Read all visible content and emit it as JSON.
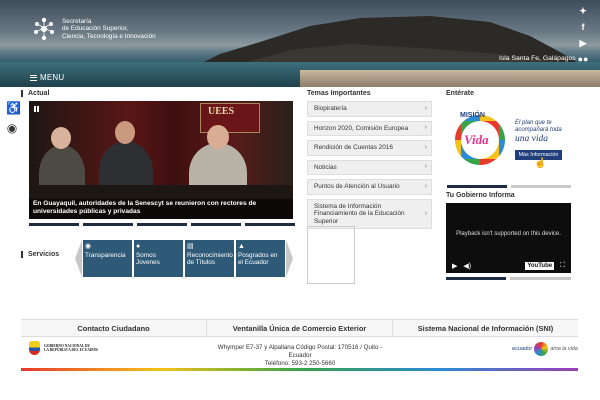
{
  "header": {
    "logo_lines": [
      "Secretaría",
      "de Educación Superior,",
      "Ciencia, Tecnología e Innovación"
    ],
    "menu_label": "MENU",
    "location": "Isla Santa Fe, Galápagos",
    "social_icons": [
      "twitter-icon",
      "facebook-icon",
      "youtube-icon",
      "flickr-icon"
    ]
  },
  "tools": [
    "accessibility-icon",
    "eye-icon"
  ],
  "actual": {
    "title": "Actual",
    "banner_text": "UEES",
    "caption": "En Guayaquil, autoridades de la Senescyt se reunieron con rectores de universidades públicas y privadas"
  },
  "servicios": {
    "title": "Servicios",
    "items": [
      {
        "icon": "eye-icon",
        "label": "Transparencia"
      },
      {
        "icon": "person-icon",
        "label": "Somos Jovenes"
      },
      {
        "icon": "document-icon",
        "label": "Reconocimiento de Títulos"
      },
      {
        "icon": "graduation-cap-icon",
        "label": "Posgrados en el Ecuador"
      }
    ]
  },
  "temas": {
    "title": "Temas Importantes",
    "items": [
      "Biopiratería",
      "Horizon 2020, Comisión Europea",
      "Rendición de Cuentas 2016",
      "Noticias",
      "Puntos de Atención al Usuario",
      "Sistema de Información Financiamiento de la Educación Superior"
    ]
  },
  "enterate": {
    "title": "Entérate",
    "mision": "MISIÓN",
    "vida": "Vida",
    "plan_text": "El plan que te acompañará toda",
    "una_vida": "una vida",
    "button": "Más Información"
  },
  "gobierno": {
    "title": "Tu Gobierno Informa",
    "message": "Playback isn't supported on this device.",
    "yt_label": "YouTube"
  },
  "footer": {
    "links": [
      "Contacto Ciudadano",
      "Ventanilla Única de Comercio Exterior",
      "Sistema Nacional de Información (SNI)"
    ],
    "gov_lines": [
      "GOBIERNO NACIONAL DE",
      "LA REPÚBLICA DEL ECUADOR"
    ],
    "address_line1": "Whymper E7-37 y Alpallana Código Postal: 170516 / Quito - Ecuador",
    "address_line2": "Teléfono: 593-2 250-5660",
    "brand_left": "ecuador",
    "brand_right": "ama la vida"
  }
}
